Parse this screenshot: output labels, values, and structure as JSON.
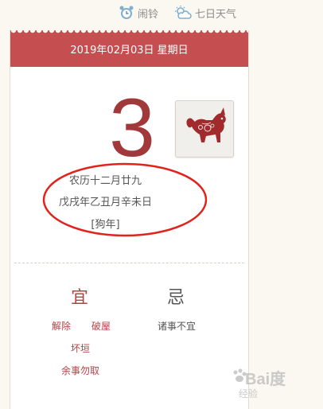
{
  "toolbar": {
    "alarm_label": "闹铃",
    "weather_label": "七日天气"
  },
  "calendar": {
    "date_header": "2019年02月03日 星期日",
    "day_number": "3",
    "lunar_date": "农历十二月廿九",
    "ganzhi": "戊戌年乙丑月辛未日",
    "zodiac_year": "[狗年]",
    "zodiac_icon": "dog-papercut-icon"
  },
  "almanac": {
    "yi_title": "宜",
    "ji_title": "忌",
    "yi_items": [
      "解除",
      "破屋",
      "坏垣",
      "余事勿取"
    ],
    "ji_items": [
      "诸事不宜"
    ]
  },
  "colors": {
    "header_red": "#c44e50",
    "day_red": "#a1393b",
    "annotation_red": "#e0231c"
  },
  "watermark": {
    "brand": "Bai度",
    "sub": "经验"
  }
}
